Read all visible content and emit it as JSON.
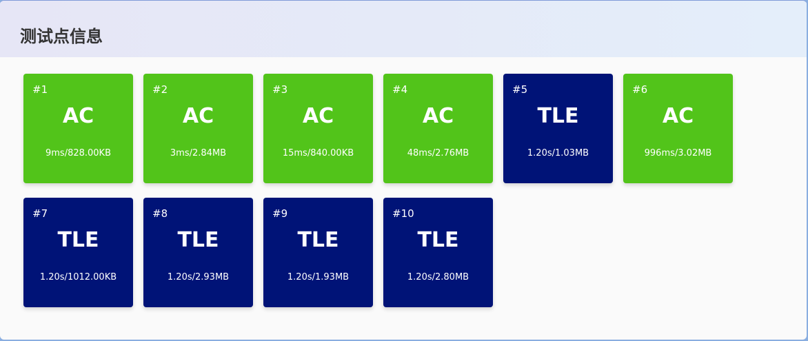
{
  "title": "测试点信息",
  "colors": {
    "AC": "#52c41a",
    "TLE": "#001377"
  },
  "cases": [
    {
      "num": "#1",
      "status": "AC",
      "stat": "9ms/828.00KB"
    },
    {
      "num": "#2",
      "status": "AC",
      "stat": "3ms/2.84MB"
    },
    {
      "num": "#3",
      "status": "AC",
      "stat": "15ms/840.00KB"
    },
    {
      "num": "#4",
      "status": "AC",
      "stat": "48ms/2.76MB"
    },
    {
      "num": "#5",
      "status": "TLE",
      "stat": "1.20s/1.03MB"
    },
    {
      "num": "#6",
      "status": "AC",
      "stat": "996ms/3.02MB"
    },
    {
      "num": "#7",
      "status": "TLE",
      "stat": "1.20s/1012.00KB"
    },
    {
      "num": "#8",
      "status": "TLE",
      "stat": "1.20s/2.93MB"
    },
    {
      "num": "#9",
      "status": "TLE",
      "stat": "1.20s/1.93MB"
    },
    {
      "num": "#10",
      "status": "TLE",
      "stat": "1.20s/2.80MB"
    }
  ]
}
